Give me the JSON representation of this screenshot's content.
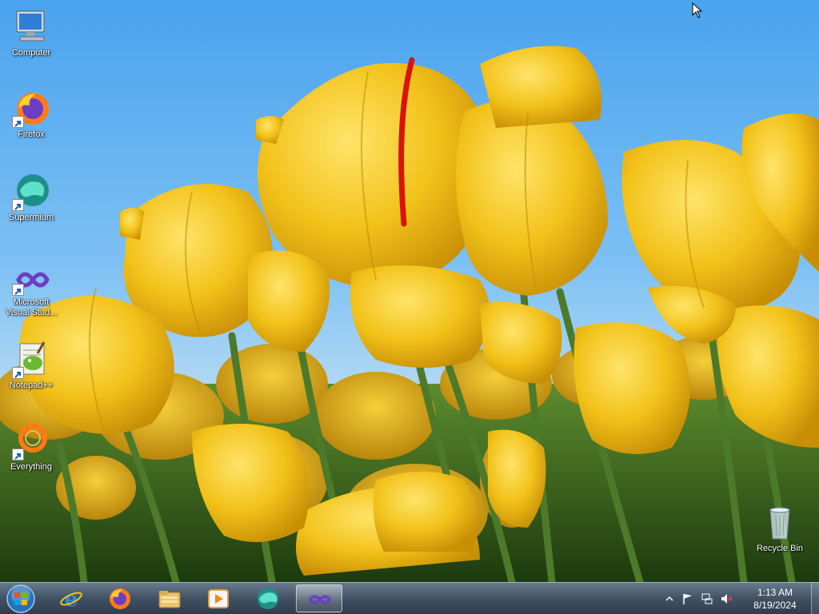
{
  "desktop": {
    "icons": [
      {
        "label": "Computer",
        "icon": "computer-icon"
      },
      {
        "label": "Firefox",
        "icon": "firefox-icon"
      },
      {
        "label": "Supermium",
        "icon": "supermium-icon"
      },
      {
        "label": "Microsoft Visual Stud...",
        "icon": "visual-studio-icon"
      },
      {
        "label": "Notepad++",
        "icon": "notepad-plus-plus-icon"
      },
      {
        "label": "Everything",
        "icon": "everything-search-icon"
      },
      {
        "label": "Recycle Bin",
        "icon": "recycle-bin-icon"
      }
    ]
  },
  "taskbar": {
    "pinned": [
      {
        "icon": "internet-explorer-icon"
      },
      {
        "icon": "firefox-icon"
      },
      {
        "icon": "file-explorer-icon"
      },
      {
        "icon": "media-player-icon"
      },
      {
        "icon": "supermium-icon"
      },
      {
        "icon": "visual-studio-icon",
        "active": true
      }
    ],
    "tray": {
      "time": "1:13 AM",
      "date": "8/19/2024",
      "icons": [
        "show-hidden-icons-chevron",
        "action-center-flag-icon",
        "network-icon",
        "volume-muted-icon"
      ]
    }
  },
  "colors": {
    "sky": "#4aa3ee",
    "tulip": "#f2c21a",
    "stem": "#4c7a2a",
    "taskbar": "#37485c"
  }
}
